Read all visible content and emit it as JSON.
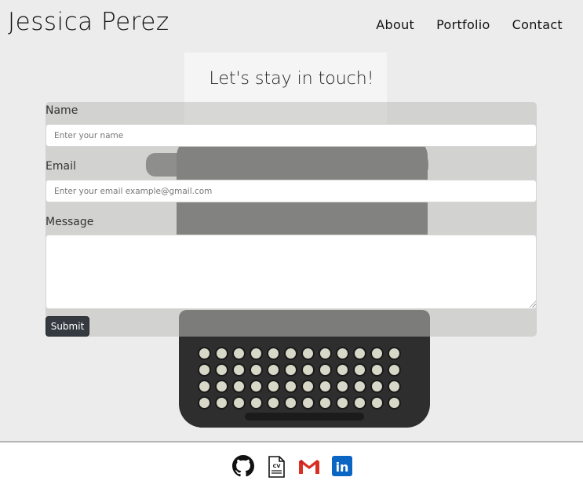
{
  "header": {
    "brand": "Jessica Perez",
    "nav": [
      "About",
      "Portfolio",
      "Contact"
    ]
  },
  "contact": {
    "heading": "Let's stay in touch!",
    "name_label": "Name",
    "name_placeholder": "Enter your name",
    "email_label": "Email",
    "email_placeholder": "Enter your email example@gmail.com",
    "message_label": "Message",
    "submit_label": "Submit"
  },
  "footer": {
    "icons": [
      "github-icon",
      "cv-document-icon",
      "gmail-icon",
      "linkedin-icon"
    ],
    "cv_text": "CV",
    "linkedin_text": "in",
    "colors": {
      "linkedin": "#0a66c2",
      "gmail_red": "#d93025"
    }
  }
}
